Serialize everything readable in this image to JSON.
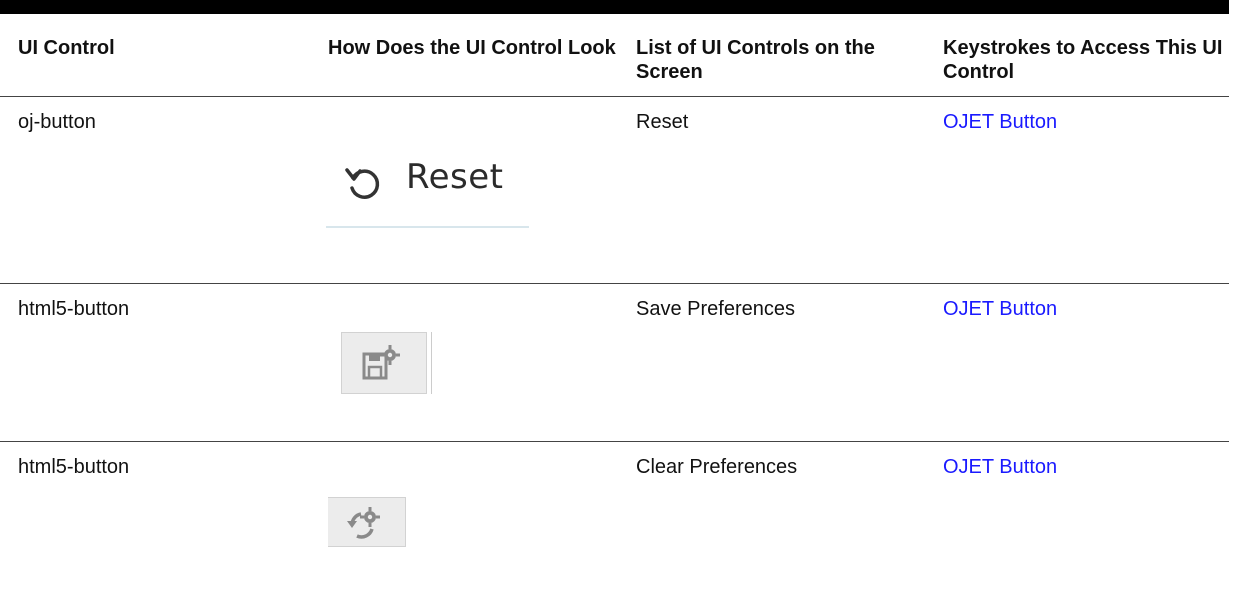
{
  "columns": [
    "UI Control",
    "How Does the UI Control Look",
    "List of UI Controls on the Screen",
    "Keystrokes to Access This UI Control"
  ],
  "rows": [
    {
      "control": "oj-button",
      "look": {
        "icon": "reset-icon",
        "label": "Reset"
      },
      "screen_control": "Reset",
      "keystrokes": "OJET Button"
    },
    {
      "control": "html5-button",
      "look": {
        "icon": "save-preferences-icon"
      },
      "screen_control": "Save Preferences",
      "keystrokes": "OJET Button"
    },
    {
      "control": "html5-button",
      "look": {
        "icon": "clear-preferences-icon"
      },
      "screen_control": "Clear Preferences",
      "keystrokes": "OJET Button"
    }
  ],
  "colors": {
    "link": "#1a1aff",
    "rule": "#000000",
    "icon_gray": "#8a8a8a"
  }
}
